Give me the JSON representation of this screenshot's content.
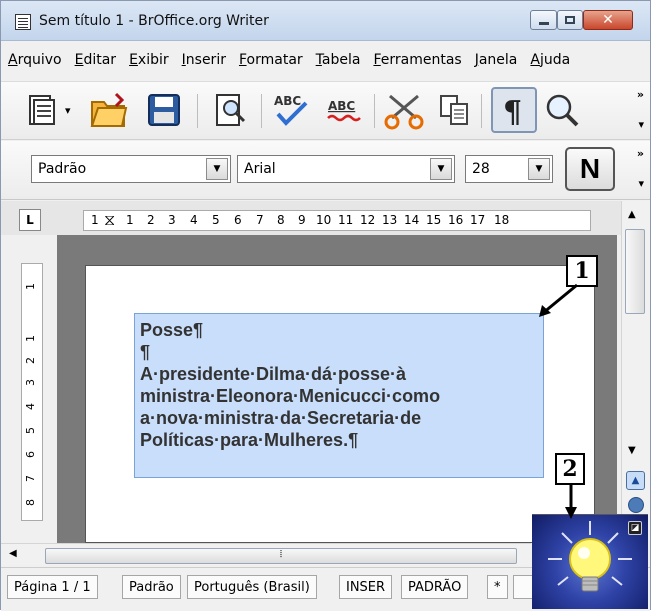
{
  "window": {
    "title": "Sem título 1 - BrOffice.org Writer",
    "close_symbol": "✕"
  },
  "menu": [
    "Arquivo",
    "Editar",
    "Exibir",
    "Inserir",
    "Formatar",
    "Tabela",
    "Ferramentas",
    "Janela",
    "Ajuda"
  ],
  "toolbar": {
    "icons": [
      "templates-icon",
      "open-folder-icon",
      "save-icon",
      "print-preview-icon",
      "spellcheck-icon",
      "autospell-icon",
      "cut-icon",
      "copy-icon",
      "formatting-marks-icon",
      "zoom-icon"
    ],
    "overflow_symbol": "»"
  },
  "format": {
    "style": "Padrão",
    "font": "Arial",
    "size": "28",
    "bold_label": "N"
  },
  "ruler": {
    "tab_selector": "L",
    "h_ticks": [
      "1",
      "1",
      "2",
      "3",
      "4",
      "5",
      "6",
      "7",
      "8",
      "9",
      "10",
      "11",
      "12",
      "13",
      "14",
      "15",
      "16",
      "17",
      "18"
    ],
    "v_ticks": [
      "1",
      "1",
      "2",
      "3",
      "4",
      "5",
      "6",
      "7",
      "8"
    ]
  },
  "document": {
    "lines": [
      "Posse¶",
      "¶",
      "A·presidente·Dilma·dá·posse·à",
      "ministra·Eleonora·Menicucci·como",
      "a·nova·ministra·da·Secretaria·de",
      "Políticas·para·Mulheres.¶"
    ]
  },
  "status": {
    "page": "Página 1 / 1",
    "style": "Padrão",
    "language": "Português (Brasil)",
    "insert_mode": "INSER",
    "selection_mode": "PADRÃO",
    "modified": "*"
  },
  "callouts": [
    "1",
    "2"
  ],
  "colors": {
    "selection": "#c9defb",
    "selection_border": "#7aa4d8",
    "title_gradient_top": "#dce7f5"
  }
}
